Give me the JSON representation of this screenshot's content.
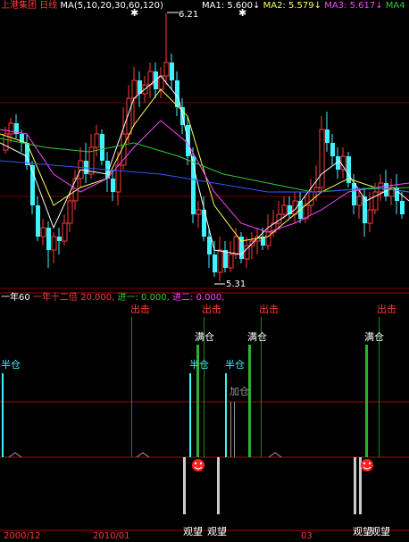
{
  "top_panel": {
    "stock_name": "上港集团",
    "period": "日线",
    "ma_label": "MA(5,10,20,30,60,120)",
    "ma1": "MA1: 5.600",
    "ma1_arrow": "↓",
    "ma2": "MA2: 5.579",
    "ma2_arrow": "↓",
    "ma3": "MA3: 5.617",
    "ma3_arrow": "↓",
    "ma4": "MA4",
    "high_label": "6.21",
    "low_label": "5.31"
  },
  "bottom_panel": {
    "indicator_name": "一年60",
    "line1": "一年十二倍",
    "val1": "20.000,",
    "line2": "进一:",
    "val2": "0.000,",
    "line3": "进二:",
    "val3": "0.000,",
    "signals": {
      "exit": "出击",
      "full": "满仓",
      "half": "半仓",
      "add": "加仓",
      "watch": "观望"
    },
    "x_dates": [
      "2000/12",
      "2010/01",
      "03"
    ]
  },
  "colors": {
    "up": "#ff3a3a",
    "down": "#3ff3ff",
    "ma1": "#ffffff",
    "ma2": "#ffff55",
    "ma3": "#ff44ff",
    "ma4": "#33cc33",
    "ma5": "#3355ff",
    "ma6": "#999999",
    "grid": "#8b0000"
  }
}
